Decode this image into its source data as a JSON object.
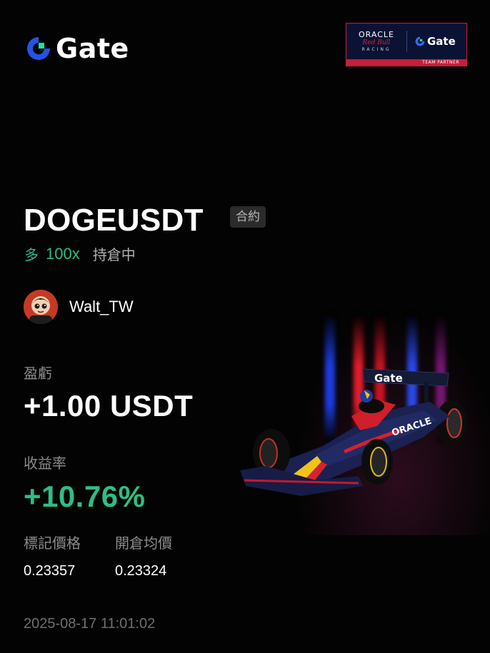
{
  "brand": {
    "name": "Gate",
    "accent": "#2354e6",
    "accent2": "#17e6a1"
  },
  "partner": {
    "oracle": "ORACLE",
    "redbull": "Red Bull",
    "racing": "RACING",
    "gate": "Gate",
    "team_partner": "TEAM PARTNER"
  },
  "position": {
    "symbol": "DOGEUSDT",
    "type_tag": "合約",
    "side": "多",
    "leverage": "100x",
    "status": "持倉中"
  },
  "user": {
    "name": "Walt_TW"
  },
  "pnl": {
    "label": "盈虧",
    "value": "+1.00 USDT"
  },
  "roi": {
    "label": "收益率",
    "value": "+10.76%"
  },
  "prices": {
    "mark_label": "標記價格",
    "mark_value": "0.23357",
    "entry_label": "開倉均價",
    "entry_value": "0.23324"
  },
  "timestamp": "2025-08-17 11:01:02",
  "colors": {
    "profit": "#2ebd85",
    "muted": "#8c8c8c",
    "background": "#030303"
  }
}
